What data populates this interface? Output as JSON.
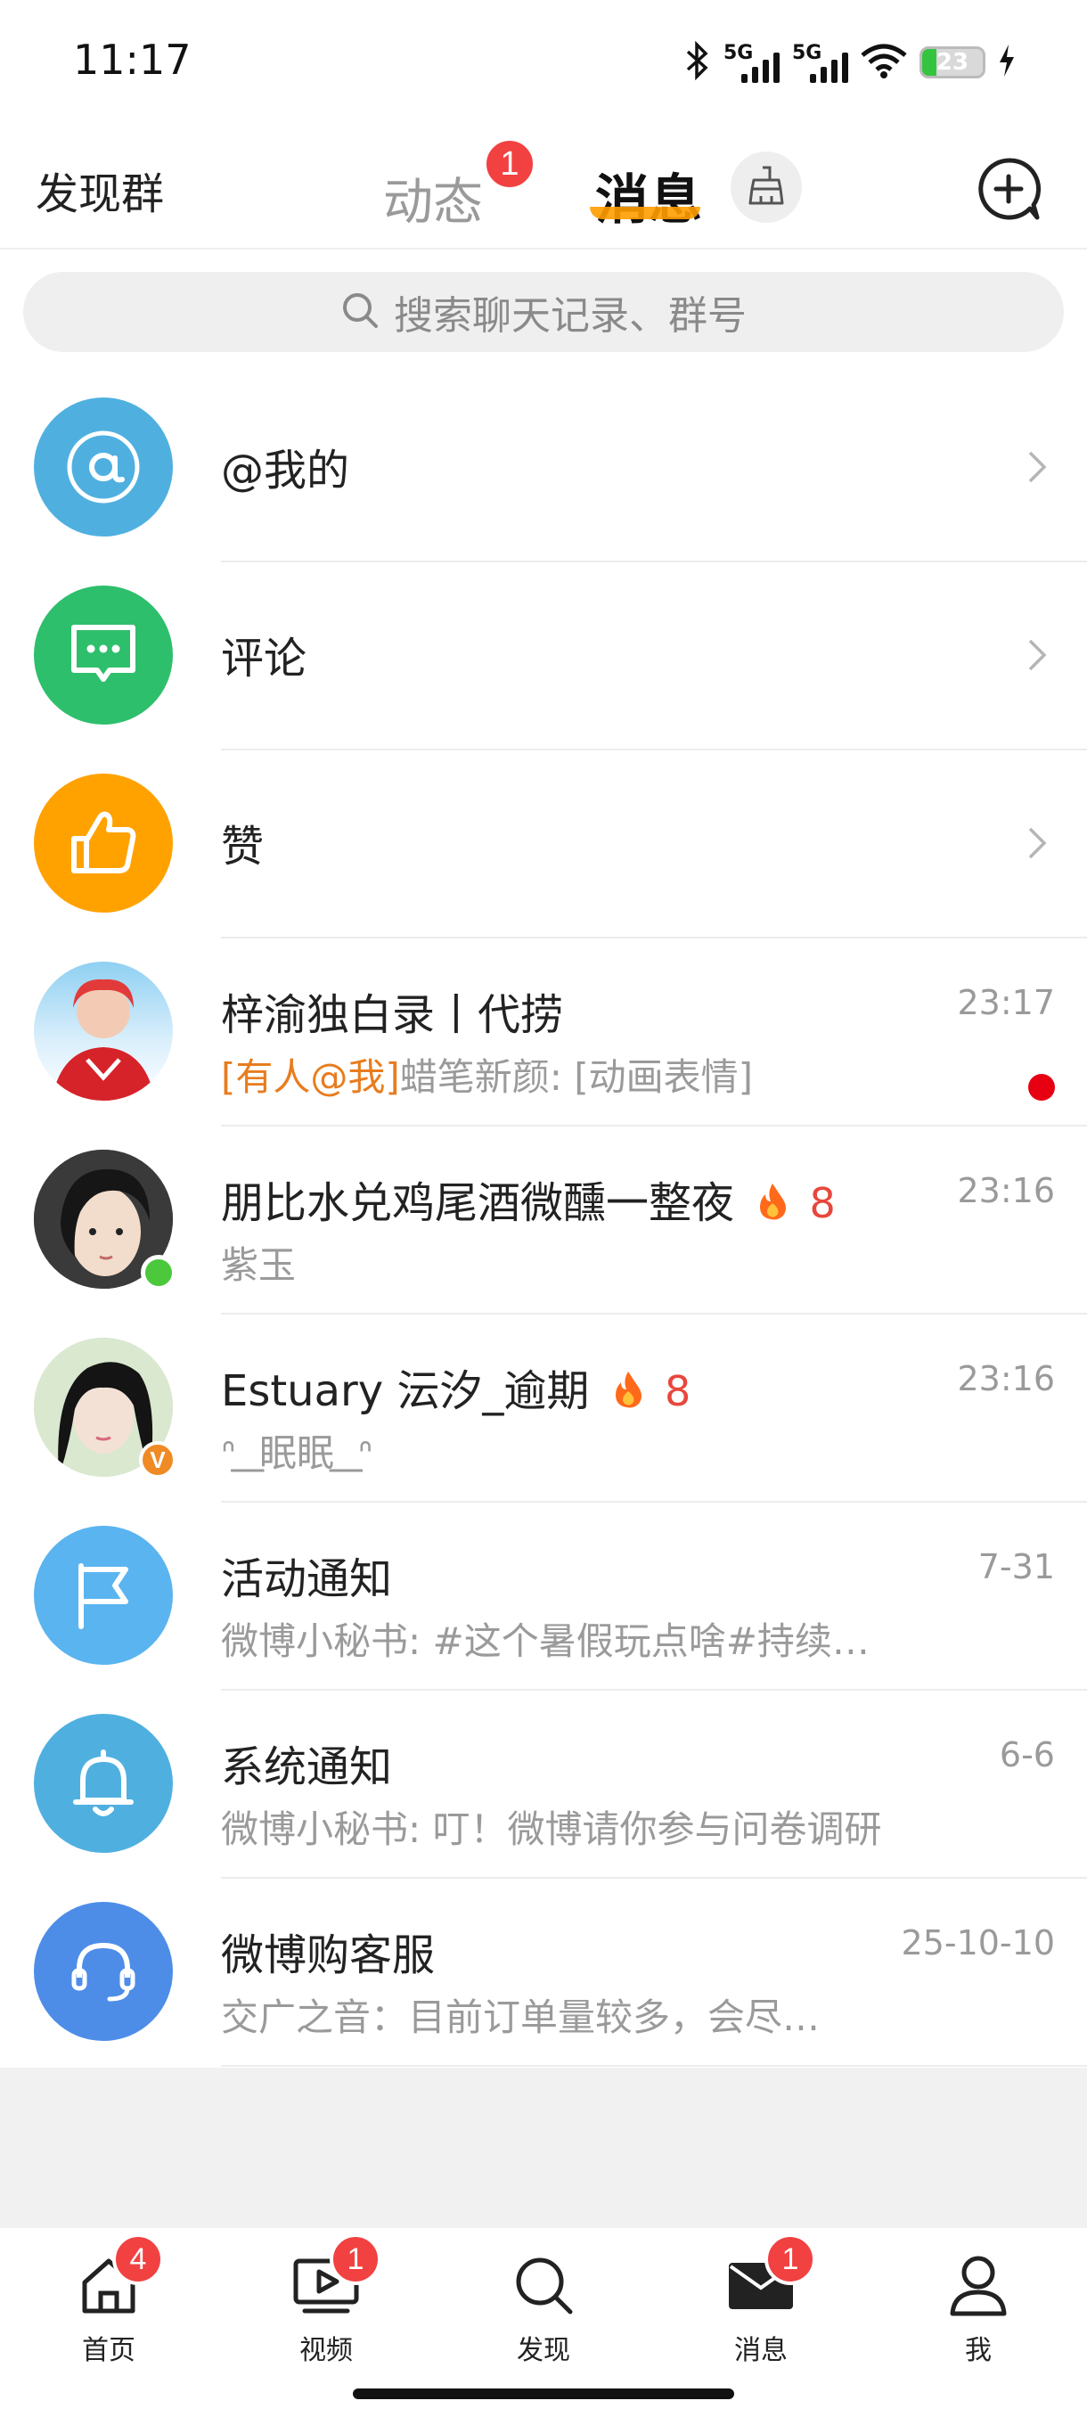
{
  "status_bar": {
    "time": "11:17",
    "network_1": "5G",
    "network_2": "5G",
    "battery": "23",
    "icons": [
      "bluetooth-icon",
      "signal-icon",
      "signal-icon",
      "wifi-icon",
      "battery-icon",
      "charging-icon"
    ]
  },
  "header": {
    "left_link": "发现群",
    "tabs": [
      {
        "label": "动态",
        "badge": "1",
        "active": false
      },
      {
        "label": "消息",
        "active": true
      }
    ],
    "accent_color": "#ff9c00",
    "icons": [
      "broom-icon",
      "compose-icon"
    ]
  },
  "search": {
    "placeholder": "搜索聊天记录、群号",
    "icon": "search-icon"
  },
  "conversations": [
    {
      "title": "@我的",
      "icon": "at-icon",
      "color": "#4fb0e0"
    },
    {
      "title": "评论",
      "icon": "comment-icon",
      "color": "#2ebf6c"
    },
    {
      "title": "赞",
      "icon": "thumbs-up-icon",
      "color": "#ffa200"
    },
    {
      "title": "梓渝独白录丨代捞",
      "mention": "[有人@我]",
      "preview": "蜡笔新颜: [动画表情]",
      "time": "23:17",
      "unread_dot": true
    },
    {
      "title": "朋比水兑鸡尾酒微醺一整夜",
      "flame": "8",
      "preview": "紫玉",
      "time": "23:16",
      "online": true
    },
    {
      "title": "Estuary 沄汐_逾期",
      "flame": "8",
      "preview": "ᐢ ͟ 眠眠 ͟ ᐢ",
      "time": "23:16",
      "verified": "V"
    },
    {
      "title": "活动通知",
      "icon": "flag-icon",
      "color": "#5ab4f0",
      "preview": "微博小秘书: #这个暑假玩点啥#持续…",
      "time": "7-31"
    },
    {
      "title": "系统通知",
      "icon": "bell-icon",
      "color": "#4fb0e0",
      "preview": "微博小秘书: 叮！微博请你参与问卷调研",
      "time": "6-6"
    },
    {
      "title": "微博购客服",
      "icon": "headset-icon",
      "color": "#4d8de8",
      "preview": "交广之音：目前订单量较多，会尽…",
      "time": "25-10-10"
    }
  ],
  "bottom_nav": [
    {
      "label": "首页",
      "icon": "home-icon",
      "badge": "4"
    },
    {
      "label": "视频",
      "icon": "video-icon",
      "badge": "1"
    },
    {
      "label": "发现",
      "icon": "discover-search-icon"
    },
    {
      "label": "消息",
      "icon": "mail-icon",
      "badge": "1",
      "active": true
    },
    {
      "label": "我",
      "icon": "profile-icon"
    }
  ]
}
